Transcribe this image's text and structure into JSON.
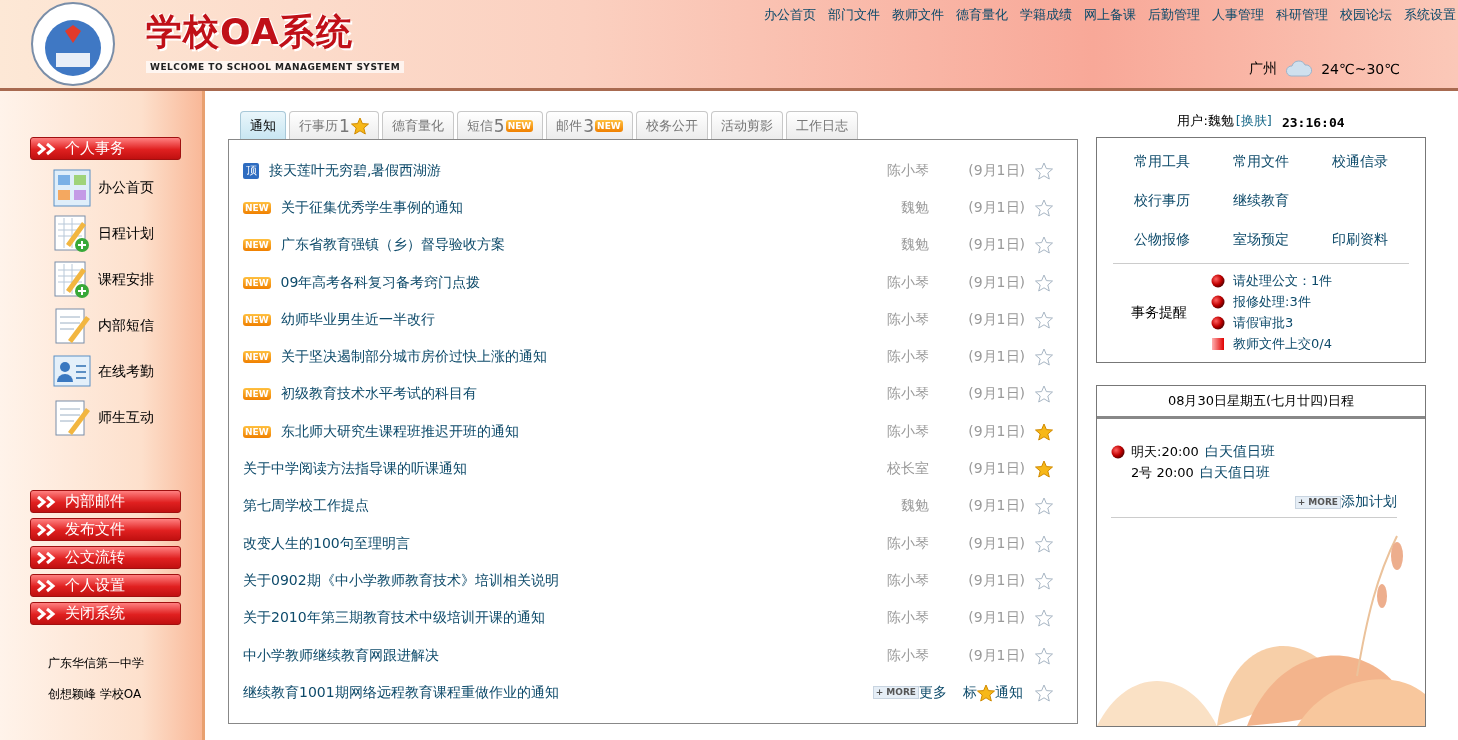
{
  "header": {
    "title": "学校OA系统",
    "subtitle": "WELCOME TO SCHOOL MANAGEMENT SYSTEM",
    "nav": [
      "办公首页",
      "部门文件",
      "教师文件",
      "德育量化",
      "学籍成绩",
      "网上备课",
      "后勤管理",
      "人事管理",
      "科研管理",
      "校园论坛",
      "系统设置"
    ],
    "weather": {
      "city": "广州",
      "temp": "24℃~30℃"
    }
  },
  "sidebar": {
    "section": "个人事务",
    "items": [
      {
        "label": "办公首页",
        "kind": "grid"
      },
      {
        "label": "日程计划",
        "kind": "plan"
      },
      {
        "label": "课程安排",
        "kind": "plan"
      },
      {
        "label": "内部短信",
        "kind": "note"
      },
      {
        "label": "在线考勤",
        "kind": "person"
      },
      {
        "label": "师生互动",
        "kind": "note"
      }
    ],
    "buttons": [
      "内部邮件",
      "发布文件",
      "公文流转",
      "个人设置",
      "关闭系统"
    ],
    "footer": [
      "广东华信第一中学",
      "创想颖峰 学校OA"
    ]
  },
  "tabs": [
    {
      "label": "通知",
      "selected": true
    },
    {
      "label": "行事历",
      "count": "1",
      "star": true,
      "selected": false
    },
    {
      "label": "德育量化",
      "selected": false
    },
    {
      "label": "短信",
      "count": "5",
      "badge": "NEW",
      "selected": false
    },
    {
      "label": "邮件",
      "count": "3",
      "badge": "NEW",
      "selected": false
    },
    {
      "label": "校务公开",
      "selected": false
    },
    {
      "label": "活动剪影",
      "selected": false
    },
    {
      "label": "工作日志",
      "selected": false
    }
  ],
  "notices": [
    {
      "title": "接天莲叶无穷碧,暑假西湖游",
      "pin": "顶",
      "author": "陈小琴",
      "date": "(9月1日)",
      "starred": false
    },
    {
      "title": "关于征集优秀学生事例的通知",
      "badge": "NEW",
      "author": "魏勉",
      "date": "(9月1日)",
      "starred": false
    },
    {
      "title": "广东省教育强镇（乡）督导验收方案",
      "badge": "NEW",
      "author": "魏勉",
      "date": "(9月1日)",
      "starred": false
    },
    {
      "title": "09年高考各科复习备考窍门点拨",
      "badge": "NEW",
      "author": "陈小琴",
      "date": "(9月1日)",
      "starred": false
    },
    {
      "title": "幼师毕业男生近一半改行",
      "badge": "NEW",
      "author": "陈小琴",
      "date": "(9月1日)",
      "starred": false
    },
    {
      "title": "关于坚决遏制部分城市房价过快上涨的通知",
      "badge": "NEW",
      "author": "陈小琴",
      "date": "(9月1日)",
      "starred": false
    },
    {
      "title": "初级教育技术水平考试的科目有",
      "badge": "NEW",
      "author": "陈小琴",
      "date": "(9月1日)",
      "starred": false
    },
    {
      "title": "东北师大研究生课程班推迟开班的通知",
      "badge": "NEW",
      "author": "陈小琴",
      "date": "(9月1日)",
      "starred": true
    },
    {
      "title": "关于中学阅读方法指导课的听课通知",
      "author": "校长室",
      "date": "(9月1日)",
      "starred": true
    },
    {
      "title": "第七周学校工作提点",
      "author": "魏勉",
      "date": "(9月1日)",
      "starred": false
    },
    {
      "title": "改变人生的100句至理明言",
      "author": "陈小琴",
      "date": "(9月1日)",
      "starred": false
    },
    {
      "title": "关于0902期《中小学教师教育技术》培训相关说明",
      "author": "陈小琴",
      "date": "(9月1日)",
      "starred": false
    },
    {
      "title": "关于2010年第三期教育技术中级培训开课的通知",
      "author": "陈小琴",
      "date": "(9月1日)",
      "starred": false
    },
    {
      "title": "中小学教师继续教育网跟进解决",
      "author": "陈小琴",
      "date": "(9月1日)",
      "starred": false
    }
  ],
  "notice_footer": {
    "title": "继续教育1001期网络远程教育课程重做作业的通知",
    "more_badge": "+ MORE",
    "more": "更多",
    "star_prefix": "标",
    "star_suffix": "通知",
    "starred": false
  },
  "user": {
    "label": "用户:魏勉",
    "skin": "[换肤]",
    "time": "23:16:04"
  },
  "tools": [
    [
      "常用工具",
      "常用文件",
      "校通信录"
    ],
    [
      "校行事历",
      "继续教育"
    ],
    [
      "公物报修",
      "室场预定",
      "印刷资料"
    ]
  ],
  "reminders": {
    "label": "事务提醒",
    "items": [
      {
        "text": "请处理公文：1件",
        "kind": "ball"
      },
      {
        "text": "报修处理:3件",
        "kind": "ball"
      },
      {
        "text": "请假审批3",
        "kind": "ball"
      },
      {
        "text": "教师文件上交0/4",
        "kind": "square"
      }
    ]
  },
  "schedule": {
    "title": "08月30日星期五(七月廿四)日程",
    "entries": [
      {
        "when": "明天:20:00",
        "event": "白天值日班",
        "bullet": true
      },
      {
        "when": "2号 20:00",
        "event": "白天值日班",
        "bullet": false
      }
    ],
    "more_badge": "+ MORE",
    "add": "添加计划"
  }
}
